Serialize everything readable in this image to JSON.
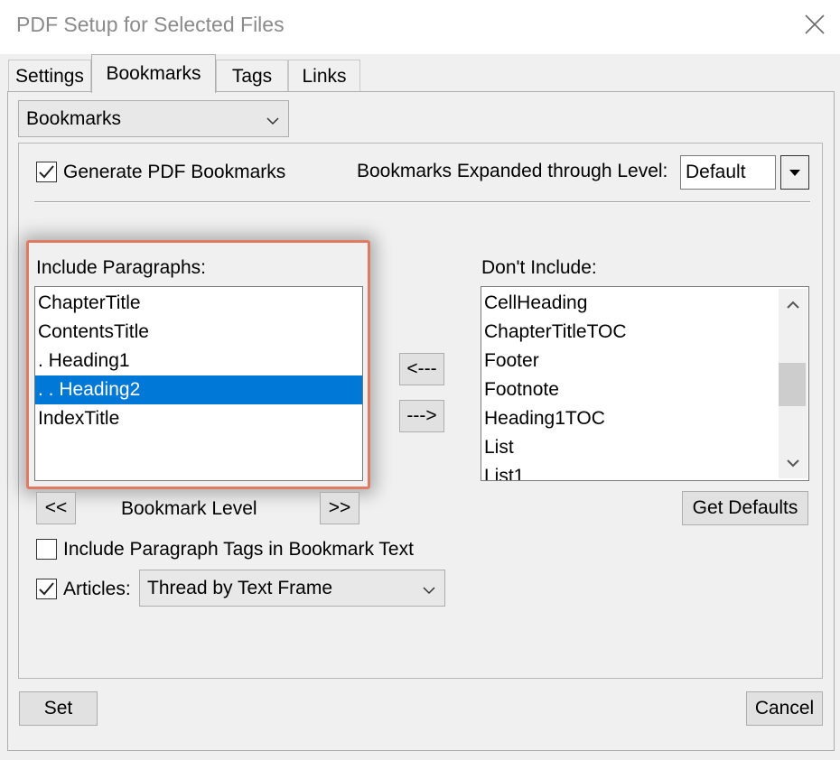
{
  "window": {
    "title": "PDF Setup for Selected Files"
  },
  "tabs": [
    {
      "label": "Settings"
    },
    {
      "label": "Bookmarks",
      "active": true
    },
    {
      "label": "Tags"
    },
    {
      "label": "Links"
    }
  ],
  "section_select": {
    "value": "Bookmarks"
  },
  "generate": {
    "label": "Generate PDF Bookmarks",
    "checked": true
  },
  "expanded": {
    "label": "Bookmarks Expanded through Level:",
    "value": "Default"
  },
  "include": {
    "label": "Include Paragraphs:",
    "items": [
      "ChapterTitle",
      "ContentsTitle",
      ". Heading1",
      ". . Heading2",
      "IndexTitle"
    ],
    "selected": ". . Heading2"
  },
  "dont_include": {
    "label": "Don't Include:",
    "items": [
      "CellHeading",
      "ChapterTitleTOC",
      "Footer",
      "Footnote",
      "Heading1TOC",
      "List",
      "List1"
    ]
  },
  "move": {
    "left": "<---",
    "right": "--->"
  },
  "level": {
    "decrease": "<<",
    "label": "Bookmark Level",
    "increase": ">>"
  },
  "get_defaults": "Get Defaults",
  "include_tags": {
    "label": "Include Paragraph Tags in Bookmark Text",
    "checked": false
  },
  "articles": {
    "label": "Articles:",
    "checked": true,
    "value": "Thread by Text Frame"
  },
  "footer": {
    "set": "Set",
    "cancel": "Cancel"
  },
  "colors": {
    "selection": "#0078d7",
    "highlight_border": "#e07a63"
  },
  "icons": [
    "close-icon",
    "chevron-down-icon",
    "checkmark-icon",
    "scroll-up-icon",
    "scroll-down-icon",
    "dropdown-arrow-icon"
  ]
}
